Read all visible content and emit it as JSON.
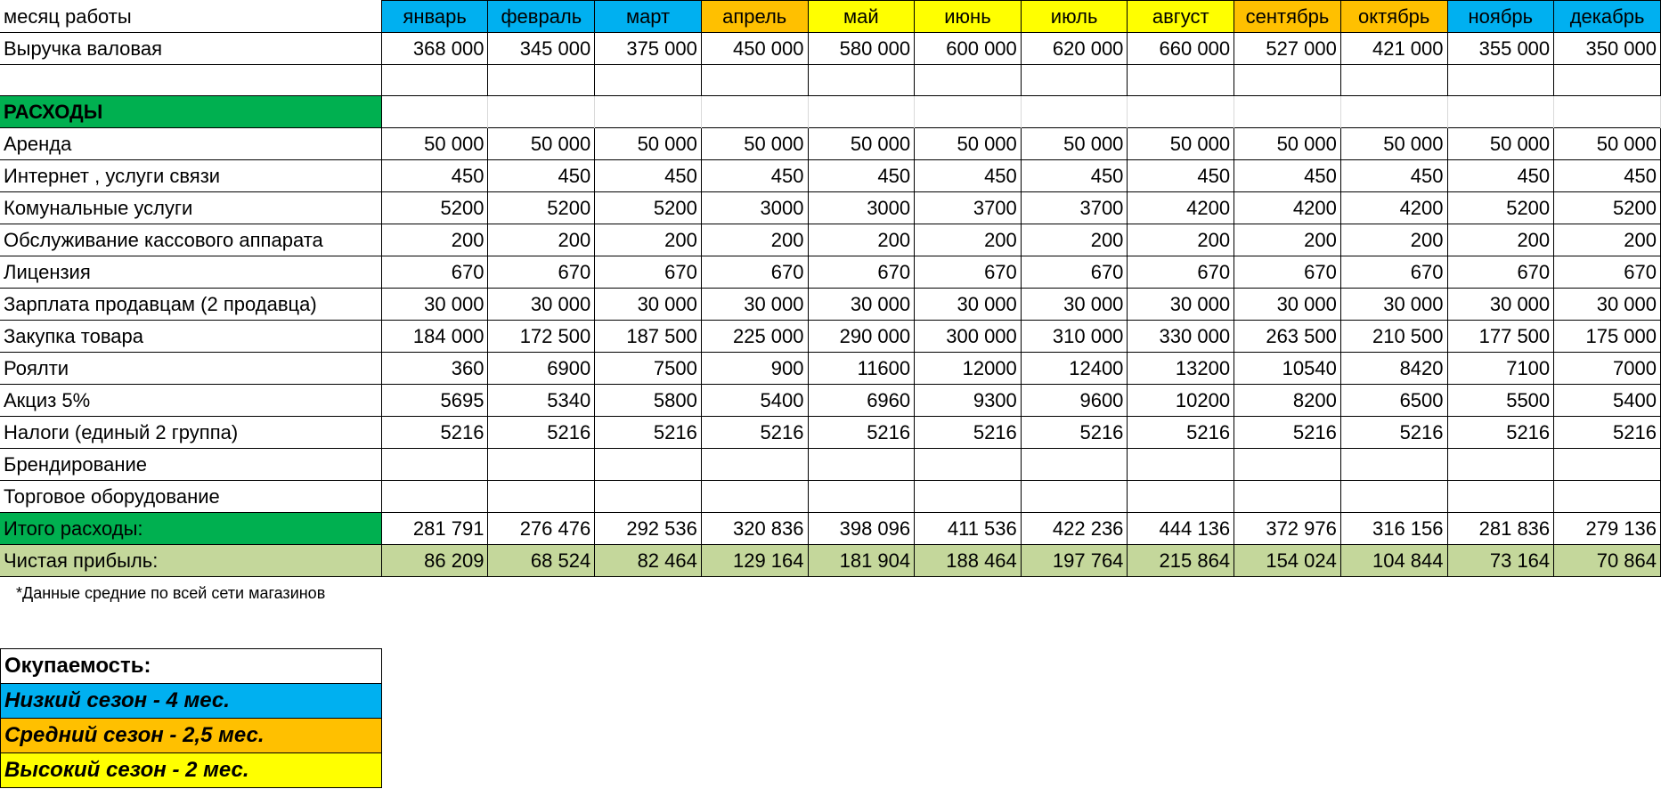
{
  "months": [
    "январь",
    "февраль",
    "март",
    "апрель",
    "май",
    "июнь",
    "июль",
    "август",
    "сентябрь",
    "октябрь",
    "ноябрь",
    "декабрь"
  ],
  "month_seasons": [
    "low",
    "low",
    "low",
    "mid",
    "high",
    "high",
    "high",
    "high",
    "mid",
    "mid",
    "low",
    "low"
  ],
  "season_colors": {
    "low": "#00b0f0",
    "mid": "#ffc000",
    "high": "#ffff00"
  },
  "header_label": "месяц работы",
  "revenue": {
    "label": "Выручка валовая",
    "values": [
      "368 000",
      "345 000",
      "375 000",
      "450 000",
      "580 000",
      "600 000",
      "620 000",
      "660 000",
      "527 000",
      "421 000",
      "355 000",
      "350 000"
    ]
  },
  "expenses_title": "РАСХОДЫ",
  "expenses": [
    {
      "label": "Аренда",
      "values": [
        "50 000",
        "50 000",
        "50 000",
        "50 000",
        "50 000",
        "50 000",
        "50 000",
        "50 000",
        "50 000",
        "50 000",
        "50 000",
        "50 000"
      ]
    },
    {
      "label": "Интернет , услуги связи",
      "values": [
        "450",
        "450",
        "450",
        "450",
        "450",
        "450",
        "450",
        "450",
        "450",
        "450",
        "450",
        "450"
      ]
    },
    {
      "label": "Комунальные услуги",
      "values": [
        "5200",
        "5200",
        "5200",
        "3000",
        "3000",
        "3700",
        "3700",
        "4200",
        "4200",
        "4200",
        "5200",
        "5200"
      ]
    },
    {
      "label": "Обслуживание кассового аппарата",
      "values": [
        "200",
        "200",
        "200",
        "200",
        "200",
        "200",
        "200",
        "200",
        "200",
        "200",
        "200",
        "200"
      ]
    },
    {
      "label": "Лицензия",
      "values": [
        "670",
        "670",
        "670",
        "670",
        "670",
        "670",
        "670",
        "670",
        "670",
        "670",
        "670",
        "670"
      ]
    },
    {
      "label": "Зарплата продавцам (2 продавца)",
      "values": [
        "30 000",
        "30 000",
        "30 000",
        "30 000",
        "30 000",
        "30 000",
        "30 000",
        "30 000",
        "30 000",
        "30 000",
        "30 000",
        "30 000"
      ]
    },
    {
      "label": "Закупка товара",
      "values": [
        "184 000",
        "172 500",
        "187 500",
        "225 000",
        "290 000",
        "300 000",
        "310 000",
        "330 000",
        "263 500",
        "210 500",
        "177 500",
        "175 000"
      ]
    },
    {
      "label": "Роялти",
      "values": [
        "360",
        "6900",
        "7500",
        "900",
        "11600",
        "12000",
        "12400",
        "13200",
        "10540",
        "8420",
        "7100",
        "7000"
      ]
    },
    {
      "label": "Акциз 5%",
      "values": [
        "5695",
        "5340",
        "5800",
        "5400",
        "6960",
        "9300",
        "9600",
        "10200",
        "8200",
        "6500",
        "5500",
        "5400"
      ]
    },
    {
      "label": "Налоги (единый 2 группа)",
      "values": [
        "5216",
        "5216",
        "5216",
        "5216",
        "5216",
        "5216",
        "5216",
        "5216",
        "5216",
        "5216",
        "5216",
        "5216"
      ]
    },
    {
      "label": "Брендирование",
      "values": [
        "",
        "",
        "",
        "",
        "",
        "",
        "",
        "",
        "",
        "",
        "",
        ""
      ]
    },
    {
      "label": "Торговое оборудование",
      "values": [
        "",
        "",
        "",
        "",
        "",
        "",
        "",
        "",
        "",
        "",
        "",
        ""
      ]
    }
  ],
  "total": {
    "label": "Итого расходы:",
    "values": [
      "281 791",
      "276 476",
      "292 536",
      "320 836",
      "398 096",
      "411 536",
      "422 236",
      "444 136",
      "372 976",
      "316 156",
      "281 836",
      "279 136"
    ]
  },
  "profit": {
    "label": "Чистая прибыль:",
    "values": [
      "86 209",
      "68 524",
      "82 464",
      "129 164",
      "181 904",
      "188 464",
      "197 764",
      "215 864",
      "154 024",
      "104 844",
      "73 164",
      "70 864"
    ]
  },
  "footnote": "*Данные средние по всей сети магазинов",
  "payback": {
    "title": "Окупаемость:",
    "low": "Низкий сезон - 4 мес.",
    "mid": "Средний сезон - 2,5 мес.",
    "high": "Высокий сезон - 2 мес."
  }
}
